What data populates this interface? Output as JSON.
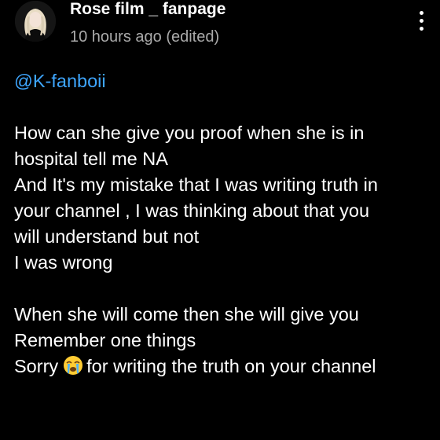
{
  "comment": {
    "author": "Rose film _ fanpage",
    "meta": "10 hours ago (edited)",
    "avatar_icon": "profile-photo-avatar",
    "more_icon": "vertical-ellipsis-icon",
    "mention": "@K-fanboii",
    "lines": [
      "How can she give you proof when she is in",
      "hospital tell me NA",
      "And It's my mistake that I was writing truth in",
      "your channel , I was thinking about that you",
      "will understand but not",
      "I was wrong",
      "When she will come then she will give you",
      "Remember one things"
    ],
    "last_line_start": "Sorry",
    "last_line_emoji": "loudly-crying-face-icon",
    "last_line_end": "for writing the truth on your channel"
  },
  "colors": {
    "background": "#000000",
    "text": "#ffffff",
    "meta": "#aaaaaa",
    "mention": "#3ea6ff",
    "emoji": "#ffcc33"
  }
}
